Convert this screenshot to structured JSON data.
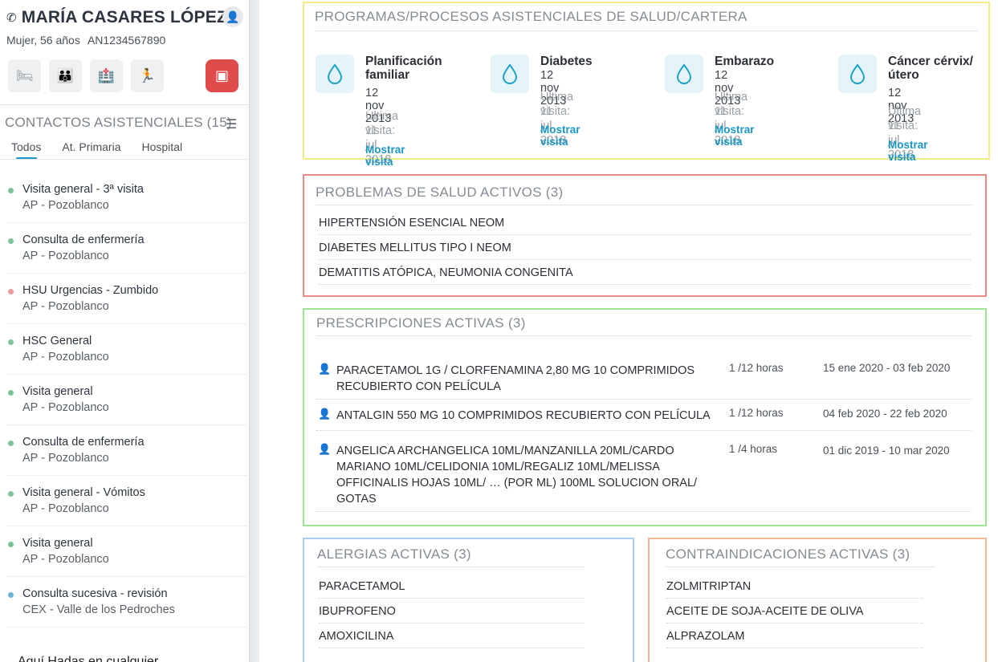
{
  "patient": {
    "name": "MARÍA CASARES LÓPEZ",
    "gender_age": "Mujer, 56 años",
    "id": "AN1234567890"
  },
  "contacts": {
    "title": "CONTACTOS ASISTENCIALES (15)",
    "tabs": [
      "Todos",
      "At. Primaria",
      "Hospital"
    ],
    "items": [
      {
        "title": "Visita general - 3ª visita",
        "sub": "AP - Pozoblanco",
        "color": "#7cc49a"
      },
      {
        "title": "Consulta de enfermería",
        "sub": "AP - Pozoblanco",
        "color": "#7cc49a"
      },
      {
        "title": "HSU Urgencias - Zumbido",
        "sub": "AP - Pozoblanco",
        "color": "#ec9a9a"
      },
      {
        "title": "HSC General",
        "sub": "AP - Pozoblanco",
        "color": "#7cc49a"
      },
      {
        "title": "Visita general",
        "sub": "AP - Pozoblanco",
        "color": "#7cc49a"
      },
      {
        "title": "Consulta de enfermería",
        "sub": "AP - Pozoblanco",
        "color": "#7cc49a"
      },
      {
        "title": "Visita general - Vómitos",
        "sub": "AP - Pozoblanco",
        "color": "#7cc49a"
      },
      {
        "title": "Visita general",
        "sub": "AP - Pozoblanco",
        "color": "#7cc49a"
      },
      {
        "title": "Consulta sucesiva - revisión",
        "sub": "CEX - Valle de los Pedroches",
        "color": "#6fb4d8"
      }
    ],
    "footer_text": "Aquí Hadas en cualquier..."
  },
  "programs": {
    "title": "PROGRAMAS/PROCESOS ASISTENCIALES DE SALUD/CARTERA",
    "items": [
      {
        "name": "Planificación familiar",
        "date": "12 nov 2013",
        "last_label": "Última visita:",
        "last_date": "11 jul 2018",
        "link": "Mostrar visita"
      },
      {
        "name": "Diabetes",
        "date": "12 nov 2013",
        "last_label": "Última visita:",
        "last_date": "11 jul 2018",
        "link": "Mostrar visita"
      },
      {
        "name": "Embarazo",
        "date": "12 nov 2013",
        "last_label": "Última visita:",
        "last_date": "11 jul 2018",
        "link": "Mostrar visita"
      },
      {
        "name": "Cáncer cérvix/ útero",
        "date": "12 nov 2013",
        "last_label": "Última visita:",
        "last_date": "11 jul 2018",
        "link": "Mostrar visita"
      }
    ]
  },
  "problems": {
    "title": "PROBLEMAS DE SALUD ACTIVOS (3)",
    "items": [
      "HIPERTENSIÓN ESENCIAL NEOM",
      "DIABETES MELLITUS TIPO I NEOM",
      "DEMATITIS ATÓPICA, NEUMONIA CONGENITA"
    ]
  },
  "prescriptions": {
    "title": "PRESCRIPCIONES ACTIVAS (3)",
    "items": [
      {
        "lines": [
          "PARACETAMOL 1G / CLORFENAMINA  2,80 MG  10 COMPRIMIDOS",
          "RECUBIERTO CON PELÍCULA"
        ],
        "dose": "1 /12 horas",
        "range": "15 ene 2020 - 03 feb 2020"
      },
      {
        "lines": [
          "ANTALGIN 550 MG 10 COMPRIMIDOS RECUBIERTO CON PELÍCULA"
        ],
        "dose": "1 /12 horas",
        "range": "04 feb 2020 - 22 feb 2020"
      },
      {
        "lines": [
          "ANGELICA ARCHANGELICA 10ML/MANZANILLA 20ML/CARDO",
          "MARIANO 10ML/CELIDONIA 10ML/REGALIZ 10ML/MELISSA",
          "OFFICINALIS HOJAS 10ML/ … (POR ML) 100ML SOLUCION ORAL/",
          "GOTAS"
        ],
        "dose": "1 /4 horas",
        "range": "01 dic 2019 - 10 mar 2020"
      }
    ]
  },
  "allergies": {
    "title": "ALERGIAS ACTIVAS (3)",
    "items": [
      "PARACETAMOL",
      "IBUPROFENO",
      "AMOXICILINA"
    ]
  },
  "contraindications": {
    "title": "CONTRAINDICACIONES ACTIVAS (3)",
    "items": [
      "ZOLMITRIPTAN",
      "ACEITE DE SOJA-ACEITE DE OLIVA",
      "ALPRAZOLAM"
    ]
  },
  "colors": {
    "programs_border": "#f3ec86",
    "problems_border": "#ec8a86",
    "prescriptions_border": "#9fe58f",
    "allergies_border": "#a9cdf0",
    "contraindications_border": "#f2b894",
    "link": "#1996c4",
    "alert_button": "#e04b4b"
  }
}
